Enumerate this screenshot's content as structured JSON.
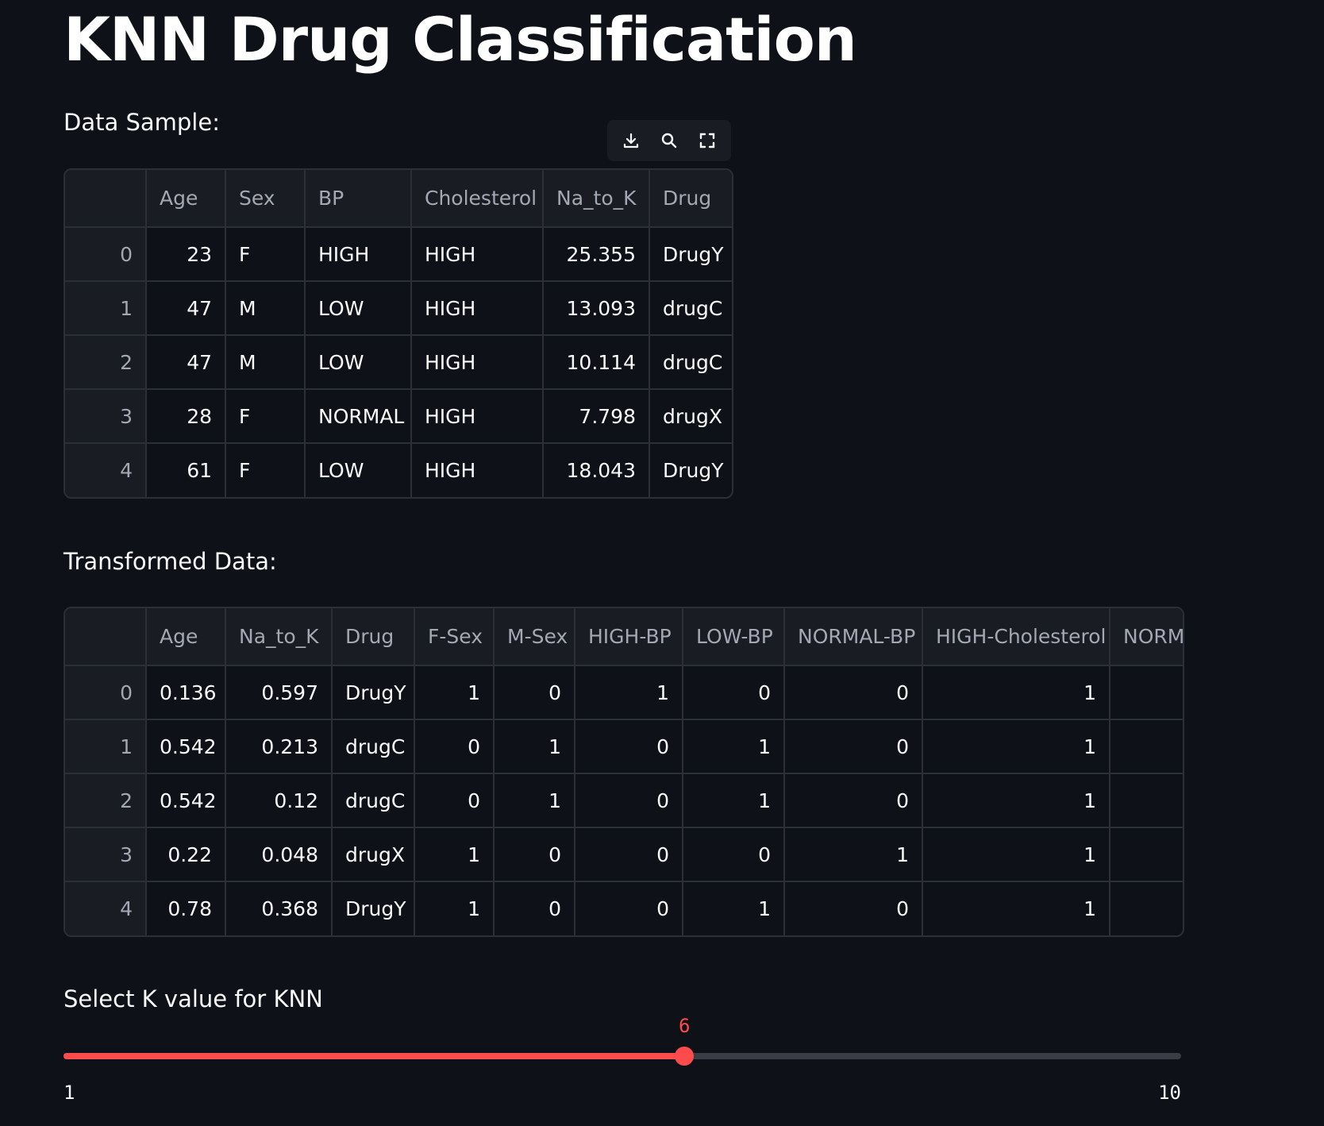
{
  "title": "KNN Drug Classification",
  "sample": {
    "label": "Data Sample:",
    "columns": [
      "",
      "Age",
      "Sex",
      "BP",
      "Cholesterol",
      "Na_to_K",
      "Drug"
    ],
    "rows": [
      [
        "0",
        "23",
        "F",
        "HIGH",
        "HIGH",
        "25.355",
        "DrugY"
      ],
      [
        "1",
        "47",
        "M",
        "LOW",
        "HIGH",
        "13.093",
        "drugC"
      ],
      [
        "2",
        "47",
        "M",
        "LOW",
        "HIGH",
        "10.114",
        "drugC"
      ],
      [
        "3",
        "28",
        "F",
        "NORMAL",
        "HIGH",
        "7.798",
        "drugX"
      ],
      [
        "4",
        "61",
        "F",
        "LOW",
        "HIGH",
        "18.043",
        "DrugY"
      ]
    ]
  },
  "toolbar": {
    "icons": [
      "download-icon",
      "search-icon",
      "fullscreen-icon"
    ]
  },
  "transformed": {
    "label": "Transformed Data:",
    "columns": [
      "",
      "Age",
      "Na_to_K",
      "Drug",
      "F-Sex",
      "M-Sex",
      "HIGH-BP",
      "LOW-BP",
      "NORMAL-BP",
      "HIGH-Cholesterol",
      "NORM."
    ],
    "rows": [
      [
        "0",
        "0.136",
        "0.597",
        "DrugY",
        "1",
        "0",
        "1",
        "0",
        "0",
        "1",
        ""
      ],
      [
        "1",
        "0.542",
        "0.213",
        "drugC",
        "0",
        "1",
        "0",
        "1",
        "0",
        "1",
        ""
      ],
      [
        "2",
        "0.542",
        "0.12",
        "drugC",
        "0",
        "1",
        "0",
        "1",
        "0",
        "1",
        ""
      ],
      [
        "3",
        "0.22",
        "0.048",
        "drugX",
        "1",
        "0",
        "0",
        "0",
        "1",
        "1",
        ""
      ],
      [
        "4",
        "0.78",
        "0.368",
        "DrugY",
        "1",
        "0",
        "0",
        "1",
        "0",
        "1",
        ""
      ]
    ]
  },
  "slider": {
    "label": "Select K value for KNN",
    "value": "6",
    "min": "1",
    "max": "10"
  },
  "colors": {
    "background": "#0e1117",
    "accent": "#ff4b4b",
    "header_bg": "#1a1c24",
    "border": "#2b2f38"
  }
}
